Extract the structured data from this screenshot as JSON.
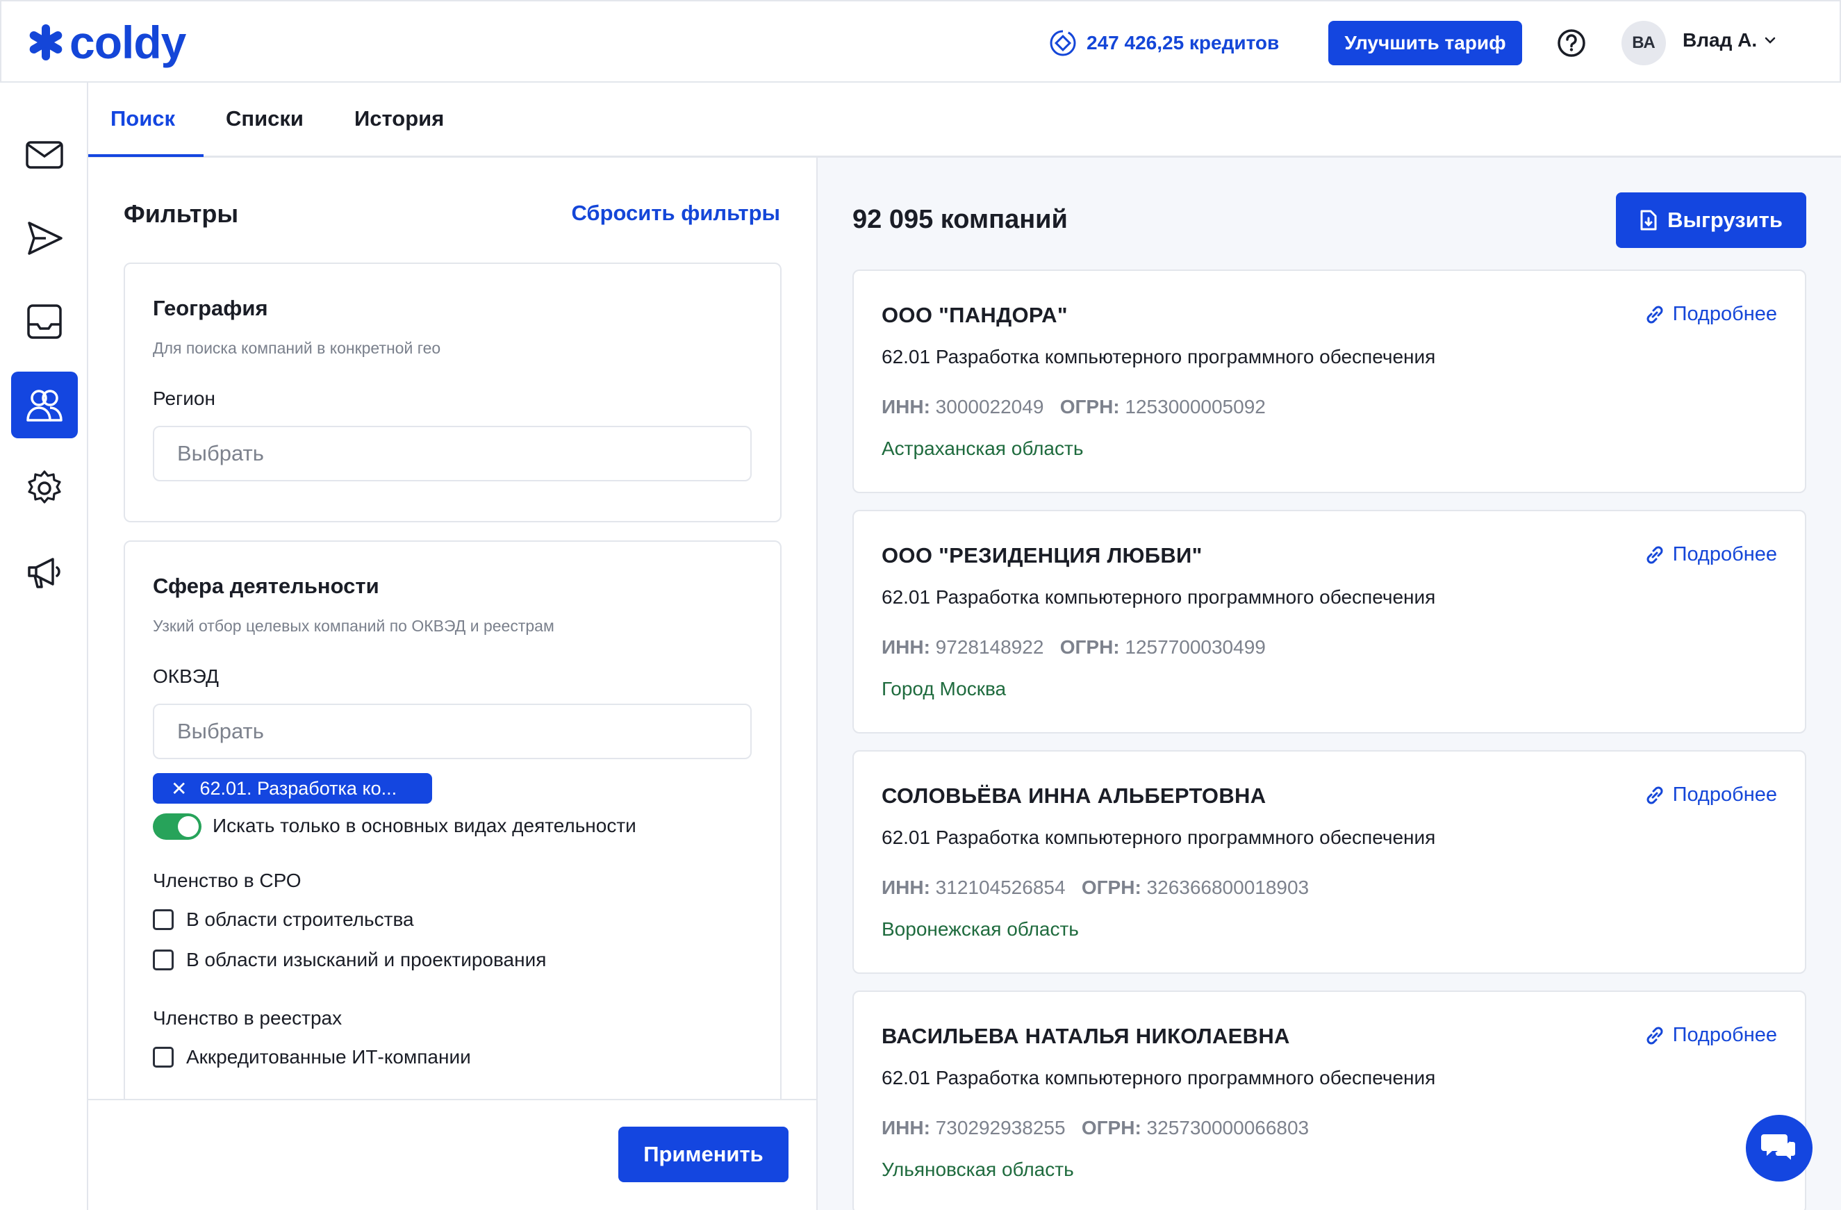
{
  "app": {
    "logo_text": "coldy"
  },
  "header": {
    "credits": "247 426,25 кредитов",
    "upgrade_label": "Улучшить тариф",
    "avatar_initials": "ВА",
    "user_name": "Влад А."
  },
  "tabs": [
    {
      "label": "Поиск",
      "active": true
    },
    {
      "label": "Списки",
      "active": false
    },
    {
      "label": "История",
      "active": false
    }
  ],
  "filters": {
    "title": "Фильтры",
    "reset_label": "Сбросить фильтры",
    "geo": {
      "title": "География",
      "subtitle": "Для поиска компаний в конкретной гео",
      "region_label": "Регион",
      "region_placeholder": "Выбрать"
    },
    "activity": {
      "title": "Сфера деятельности",
      "subtitle": "Узкий отбор целевых компаний по ОКВЭД и реестрам",
      "okved_label": "ОКВЭД",
      "okved_placeholder": "Выбрать",
      "chip": "62.01. Разработка ко...",
      "toggle_label": "Искать только в основных видах деятельности",
      "toggle_on": true,
      "sro_label": "Членство в СРО",
      "sro_options": [
        "В области строительства",
        "В области изысканий и проектирования"
      ],
      "registry_label": "Членство в реестрах",
      "registry_options": [
        "Аккредитованные ИТ-компании"
      ]
    },
    "apply_label": "Применить"
  },
  "results": {
    "count": "92 095 компаний",
    "export_label": "Выгрузить",
    "more_label": "Подробнее",
    "inn_label": "ИНН:",
    "ogrn_label": "ОГРН:",
    "companies": [
      {
        "name": "ООО \"ПАНДОРА\"",
        "okved": "62.01 Разработка компьютерного программного обеспечения",
        "inn": "3000022049",
        "ogrn": "1253000005092",
        "region": "Астраханская область"
      },
      {
        "name": "ООО \"РЕЗИДЕНЦИЯ ЛЮБВИ\"",
        "okved": "62.01 Разработка компьютерного программного обеспечения",
        "inn": "9728148922",
        "ogrn": "1257700030499",
        "region": "Город Москва"
      },
      {
        "name": "СОЛОВЬЁВА ИННА АЛЬБЕРТОВНА",
        "okved": "62.01 Разработка компьютерного программного обеспечения",
        "inn": "312104526854",
        "ogrn": "326366800018903",
        "region": "Воронежская область"
      },
      {
        "name": "ВАСИЛЬЕВА НАТАЛЬЯ НИКОЛАЕВНА",
        "okved": "62.01 Разработка компьютерного программного обеспечения",
        "inn": "730292938255",
        "ogrn": "325730000066803",
        "region": "Ульяновская область"
      }
    ]
  },
  "colors": {
    "accent": "#1446e0",
    "region_green": "#1f6b3e",
    "toggle_green": "#27a35a"
  }
}
